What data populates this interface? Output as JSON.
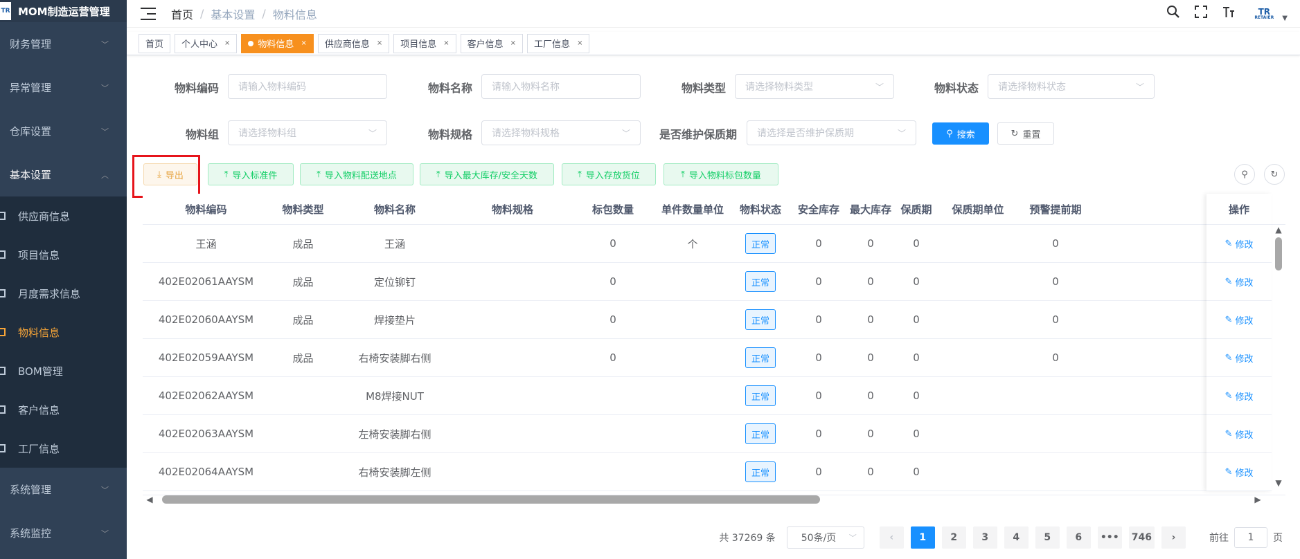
{
  "app": {
    "title": "MOM制造运营管理",
    "logo": "TR"
  },
  "sidebar": {
    "groups_top": [
      {
        "label": "财务管理"
      },
      {
        "label": "异常管理"
      },
      {
        "label": "仓库设置"
      }
    ],
    "open_group": {
      "label": "基本设置"
    },
    "sub_items": [
      {
        "label": "供应商信息",
        "active": false
      },
      {
        "label": "项目信息",
        "active": false
      },
      {
        "label": "月度需求信息",
        "active": false
      },
      {
        "label": "物料信息",
        "active": true
      },
      {
        "label": "BOM管理",
        "active": false
      },
      {
        "label": "客户信息",
        "active": false
      },
      {
        "label": "工厂信息",
        "active": false
      }
    ],
    "groups_bottom": [
      {
        "label": "系统管理"
      },
      {
        "label": "系统监控"
      }
    ]
  },
  "breadcrumb": {
    "home": "首页",
    "parent": "基本设置",
    "current": "物料信息",
    "separator": "/"
  },
  "header_icons": [
    "search-icon",
    "fullscreen-icon",
    "font-size-icon"
  ],
  "avatar": {
    "text": "TR",
    "sub": "RETAIER"
  },
  "tags": [
    {
      "label": "首页",
      "closable": false,
      "active": false
    },
    {
      "label": "个人中心",
      "closable": true,
      "active": false
    },
    {
      "label": "物料信息",
      "closable": true,
      "active": true
    },
    {
      "label": "供应商信息",
      "closable": true,
      "active": false
    },
    {
      "label": "项目信息",
      "closable": true,
      "active": false
    },
    {
      "label": "客户信息",
      "closable": true,
      "active": false
    },
    {
      "label": "工厂信息",
      "closable": true,
      "active": false
    }
  ],
  "search_form": {
    "material_code": {
      "label": "物料编码",
      "placeholder": "请输入物料编码"
    },
    "material_name": {
      "label": "物料名称",
      "placeholder": "请输入物料名称"
    },
    "material_type": {
      "label": "物料类型",
      "placeholder": "请选择物料类型"
    },
    "material_status": {
      "label": "物料状态",
      "placeholder": "请选择物料状态"
    },
    "material_group": {
      "label": "物料组",
      "placeholder": "请选择物料组"
    },
    "material_spec": {
      "label": "物料规格",
      "placeholder": "请选择物料规格"
    },
    "shelf_life": {
      "label": "是否维护保质期",
      "placeholder": "请选择是否维护保质期"
    },
    "search_btn": "搜索",
    "reset_btn": "重置"
  },
  "toolbar": {
    "export": "导出",
    "import_std": "导入标准件",
    "import_delivery": "导入物料配送地点",
    "import_max_stock": "导入最大库存/安全天数",
    "import_location": "导入存放货位",
    "import_pack_qty": "导入物料标包数量"
  },
  "table": {
    "columns": [
      "物料编码",
      "物料类型",
      "物料名称",
      "物料规格",
      "标包数量",
      "单件数量单位",
      "物料状态",
      "安全库存",
      "最大库存",
      "保质期",
      "保质期单位",
      "预警提前期"
    ],
    "op_column": "操作",
    "edit_label": "修改",
    "rows": [
      {
        "code": "王涵",
        "type": "成品",
        "name": "王涵",
        "spec": "",
        "pack": "0",
        "unit": "个",
        "status": "正常",
        "safe": "0",
        "max": "0",
        "shelf": "0",
        "shelf_unit": "",
        "warn": "0"
      },
      {
        "code": "402E02061AAYSM",
        "type": "成品",
        "name": "定位铆钉",
        "spec": "",
        "pack": "0",
        "unit": "",
        "status": "正常",
        "safe": "0",
        "max": "0",
        "shelf": "0",
        "shelf_unit": "",
        "warn": "0"
      },
      {
        "code": "402E02060AAYSM",
        "type": "成品",
        "name": "焊接垫片",
        "spec": "",
        "pack": "0",
        "unit": "",
        "status": "正常",
        "safe": "0",
        "max": "0",
        "shelf": "0",
        "shelf_unit": "",
        "warn": "0"
      },
      {
        "code": "402E02059AAYSM",
        "type": "成品",
        "name": "右椅安装脚右侧",
        "spec": "",
        "pack": "0",
        "unit": "",
        "status": "正常",
        "safe": "0",
        "max": "0",
        "shelf": "0",
        "shelf_unit": "",
        "warn": "0"
      },
      {
        "code": "402E02062AAYSM",
        "type": "",
        "name": "M8焊接NUT",
        "spec": "",
        "pack": "",
        "unit": "",
        "status": "正常",
        "safe": "0",
        "max": "0",
        "shelf": "0",
        "shelf_unit": "",
        "warn": ""
      },
      {
        "code": "402E02063AAYSM",
        "type": "",
        "name": "左椅安装脚右侧",
        "spec": "",
        "pack": "",
        "unit": "",
        "status": "正常",
        "safe": "0",
        "max": "0",
        "shelf": "0",
        "shelf_unit": "",
        "warn": ""
      },
      {
        "code": "402E02064AAYSM",
        "type": "",
        "name": "右椅安装脚左侧",
        "spec": "",
        "pack": "",
        "unit": "",
        "status": "正常",
        "safe": "0",
        "max": "0",
        "shelf": "0",
        "shelf_unit": "",
        "warn": ""
      }
    ]
  },
  "pagination": {
    "total": "共 37269 条",
    "page_size": "50条/页",
    "pages": [
      "1",
      "2",
      "3",
      "4",
      "5",
      "6",
      "•••",
      "746"
    ],
    "current": "1",
    "goto_label": "前往",
    "goto_value": "1",
    "page_unit": "页"
  },
  "colors": {
    "sidebar_bg": "#304156",
    "active_tag": "#f7901e",
    "primary": "#1890ff",
    "highlight": "#e6141b"
  }
}
